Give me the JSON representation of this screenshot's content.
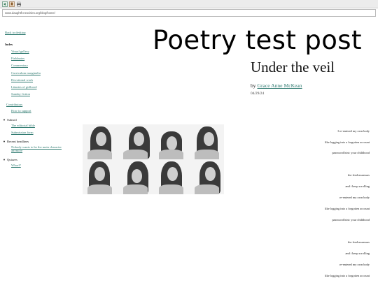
{
  "browser": {
    "url": "www.daughtfr.neocities.org/blog/home/",
    "icons": [
      "nav-icon",
      "bookmark-icon",
      "print-icon"
    ]
  },
  "sidebar": {
    "back": "Back to desktop",
    "index_title": "Index",
    "items": [
      {
        "label": "Visual gallery"
      },
      {
        "label": "Fieldnotes"
      },
      {
        "label": "Commentary"
      },
      {
        "label": "Curriculum marginalia"
      },
      {
        "label": "Devotional work"
      },
      {
        "label": "Litanies of girlhood"
      },
      {
        "label": "Sunday fiction"
      }
    ],
    "contributors": "Contributors",
    "support": "How to support",
    "sections": [
      {
        "title": "Subsoil",
        "links": [
          "The editorial bible",
          "Submission form"
        ]
      },
      {
        "title": "Recent headlines",
        "links": [
          "Nobody wants to be the main character anymore"
        ]
      },
      {
        "title": "Quizzes",
        "links": [
          "Whorl?"
        ]
      }
    ]
  },
  "post": {
    "title": "Poetry test post",
    "subtitle": "Under the veil",
    "by_prefix": "by",
    "author": "Grace Anne McKean",
    "date": "04/29/24"
  },
  "poem": [
    "I re-entered my own body",
    "like logging into a forgotten account",
    "password hint: your childhood",
    "the feed murmurs",
    "and i keep scrolling",
    "re-entered my own body",
    "like logging into a forgotten account",
    "password hint: your childhood",
    "the feed murmurs",
    "and i keep scrolling",
    "re-entered my own body",
    "like logging into a forgotten account"
  ],
  "photo_grid": {
    "count": 8
  }
}
